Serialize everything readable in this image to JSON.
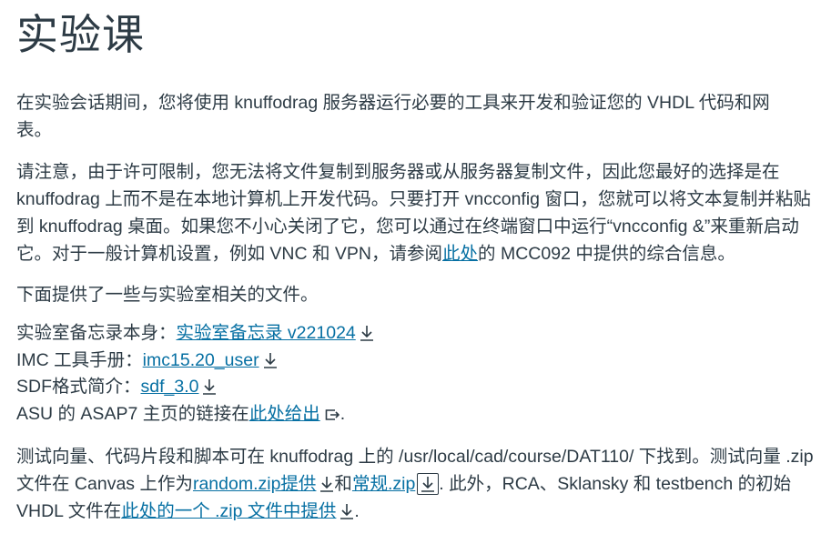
{
  "title": "实验课",
  "p1": "在实验会话期间，您将使用 knuffodrag 服务器运行必要的工具来开发和验证您的 VHDL 代码和网表。",
  "p2": {
    "before": "请注意，由于许可限制，您无法将文件复制到服务器或从服务器复制文件，因此您最好的选择是在 knuffodrag 上而不是在本地计算机上开发代码。只要打开 vncconfig 窗口，您就可以将文本复制并粘贴到 knuffodrag 桌面。如果您不小心关闭了它，您可以通过在终端窗口中运行“vncconfig &”来重新启动它。对于一般计算机设置，例如 VNC 和 VPN，请参阅",
    "link": "此处",
    "after": "的 MCC092 中提供的综合信息。"
  },
  "p3": "下面提供了一些与实验室相关的文件。",
  "files": [
    {
      "label": "实验室备忘录本身：",
      "link": "实验室备忘录 v221024",
      "icon": "download-icon"
    },
    {
      "label": "IMC 工具手册：",
      "link": "imc15.20_user",
      "icon": "download-icon"
    },
    {
      "label": "SDF格式简介：",
      "link": "sdf_3.0",
      "icon": "download-icon"
    }
  ],
  "asu": {
    "before": "ASU 的 ASAP7 主页的链接在",
    "link": "此处给出",
    "after": ".",
    "icon": "external-link-icon"
  },
  "p4": {
    "t1": "测试向量、代码片段和脚本可在 knuffodrag 上的 /usr/local/cad/course/DAT110/ 下找到。测试向量 .zip 文件在 Canvas 上作为",
    "link1": "random.zip提供",
    "t2": "和",
    "link2": "常规.zip",
    "t3": ". 此外，RCA、Sklansky 和 testbench 的初始 VHDL 文件在",
    "link3": "此处的一个 .zip 文件中提供",
    "t4": "."
  },
  "colors": {
    "text": "#2d3b45",
    "link": "#0770a3"
  }
}
